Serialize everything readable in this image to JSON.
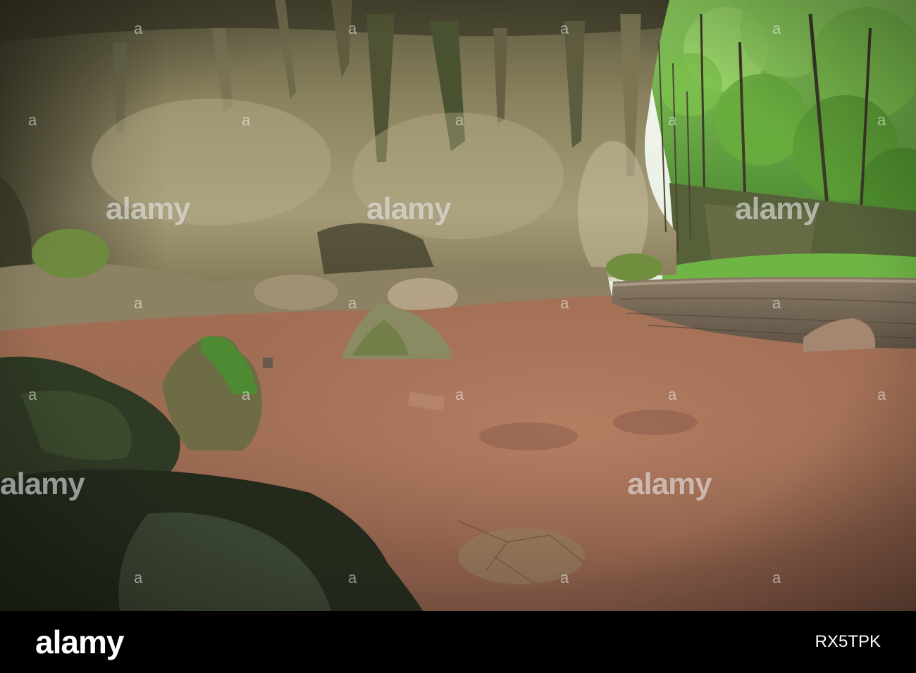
{
  "photo": {
    "subject": "limestone cave entrance with stalactites, red earth floor, stone retaining wall and green forest",
    "colors": {
      "cave_rock": "#8c8460",
      "floor": "#9a6a52",
      "forest": "#6fb545",
      "sky": "#e9efe6",
      "moss": "#4f7a32"
    }
  },
  "watermark": {
    "text": "alamy",
    "mark": "a"
  },
  "footer": {
    "logo": "alamy",
    "image_id": "RX5TPK",
    "background": "#000000"
  }
}
